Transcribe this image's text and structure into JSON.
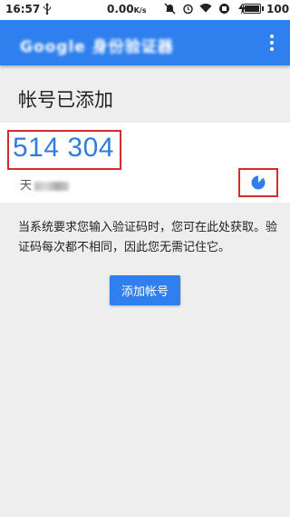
{
  "status_bar": {
    "time": "16:57",
    "usb_icon": "usb-icon",
    "speed": "0.00",
    "speed_unit": "K/s",
    "icons": [
      "mute-icon",
      "alarm-icon",
      "wifi-icon",
      "sync-icon",
      "battery-saver-icon"
    ],
    "battery_percent": "100"
  },
  "app_bar": {
    "title": "Google 身份验证器",
    "color": "#2f80ee",
    "menu_icon": "more-vert-icon"
  },
  "page": {
    "heading": "帐号已添加"
  },
  "account_card": {
    "code": "514 304",
    "account_prefix": "天",
    "timer_icon": "countdown-timer-icon",
    "highlight_color": "#d52b2b"
  },
  "description": {
    "text": "当系统要求您输入验证码时，您可在此处获取。验证码每次都不相同，因此您无需记住它。"
  },
  "actions": {
    "add_account_label": "添加帐号"
  }
}
